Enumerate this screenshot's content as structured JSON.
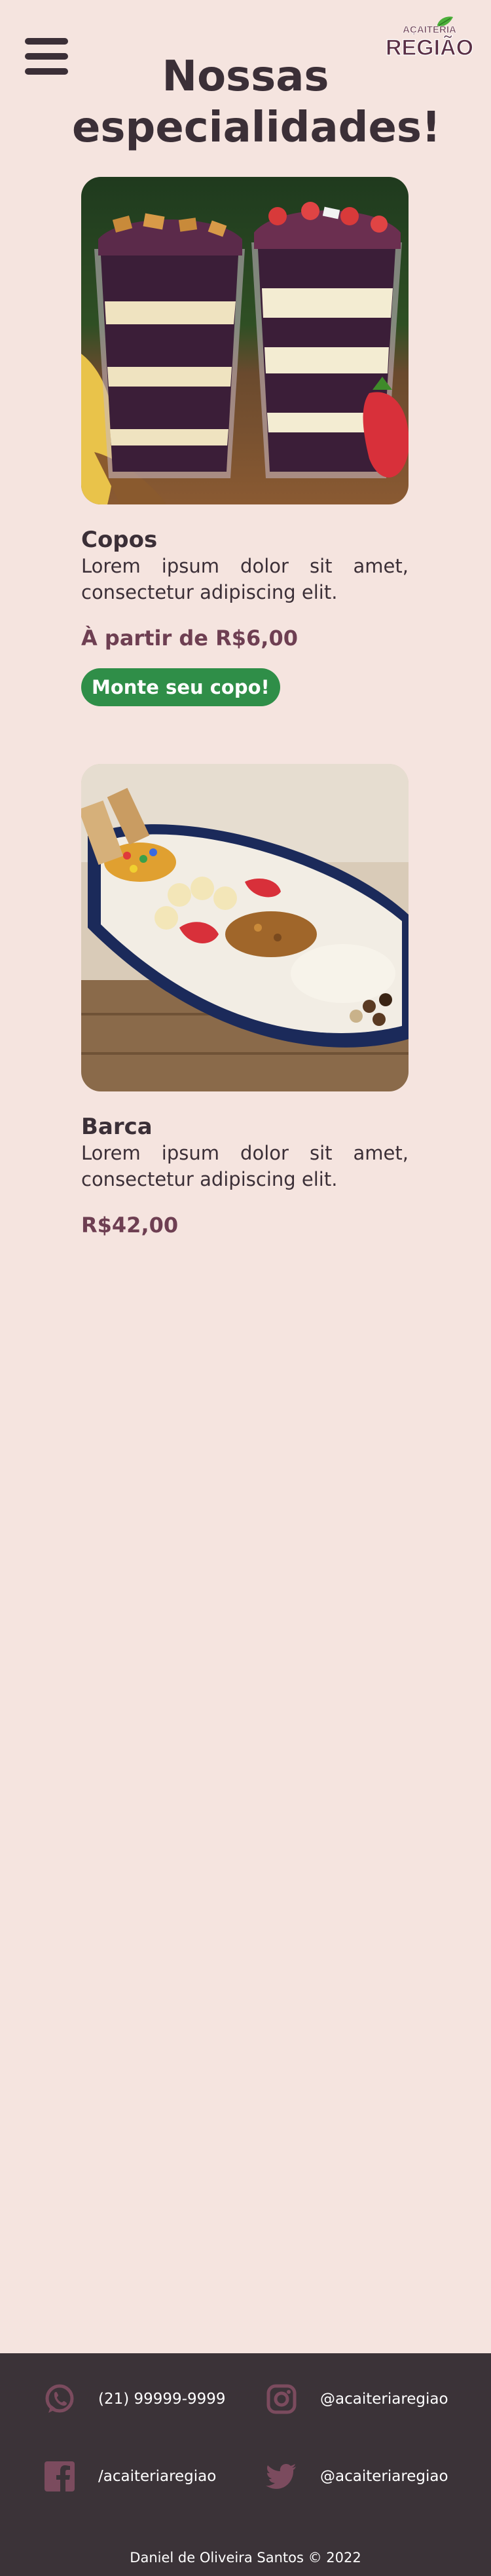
{
  "header": {
    "menu_icon": "hamburger-menu-icon",
    "logo": {
      "top_text": "AÇAITERIA",
      "main_text": "REGIÃO"
    },
    "title": "Nossas especialidades!"
  },
  "products": [
    {
      "name": "Copos",
      "description": "Lorem ipsum dolor sit amet, consectetur adipiscing elit.",
      "price": "À partir de R$6,00",
      "button_label": "Monte seu copo!"
    },
    {
      "name": "Barca",
      "description": "Lorem ipsum dolor sit amet, consectetur adipiscing elit.",
      "price": "R$42,00"
    }
  ],
  "footer": {
    "phone": "(21) 99999-9999",
    "instagram": "@acaiteriaregiao",
    "facebook": "/acaiteriaregiao",
    "twitter": "@acaiteriaregiao",
    "copyright": "Daniel de Oliveira Santos © 2022"
  },
  "colors": {
    "background": "#f5e4df",
    "text": "#3b2f37",
    "price": "#6e3f52",
    "button": "#2f8e48",
    "footer_bg": "#3b3338",
    "footer_icons": "#7b4b5e"
  }
}
